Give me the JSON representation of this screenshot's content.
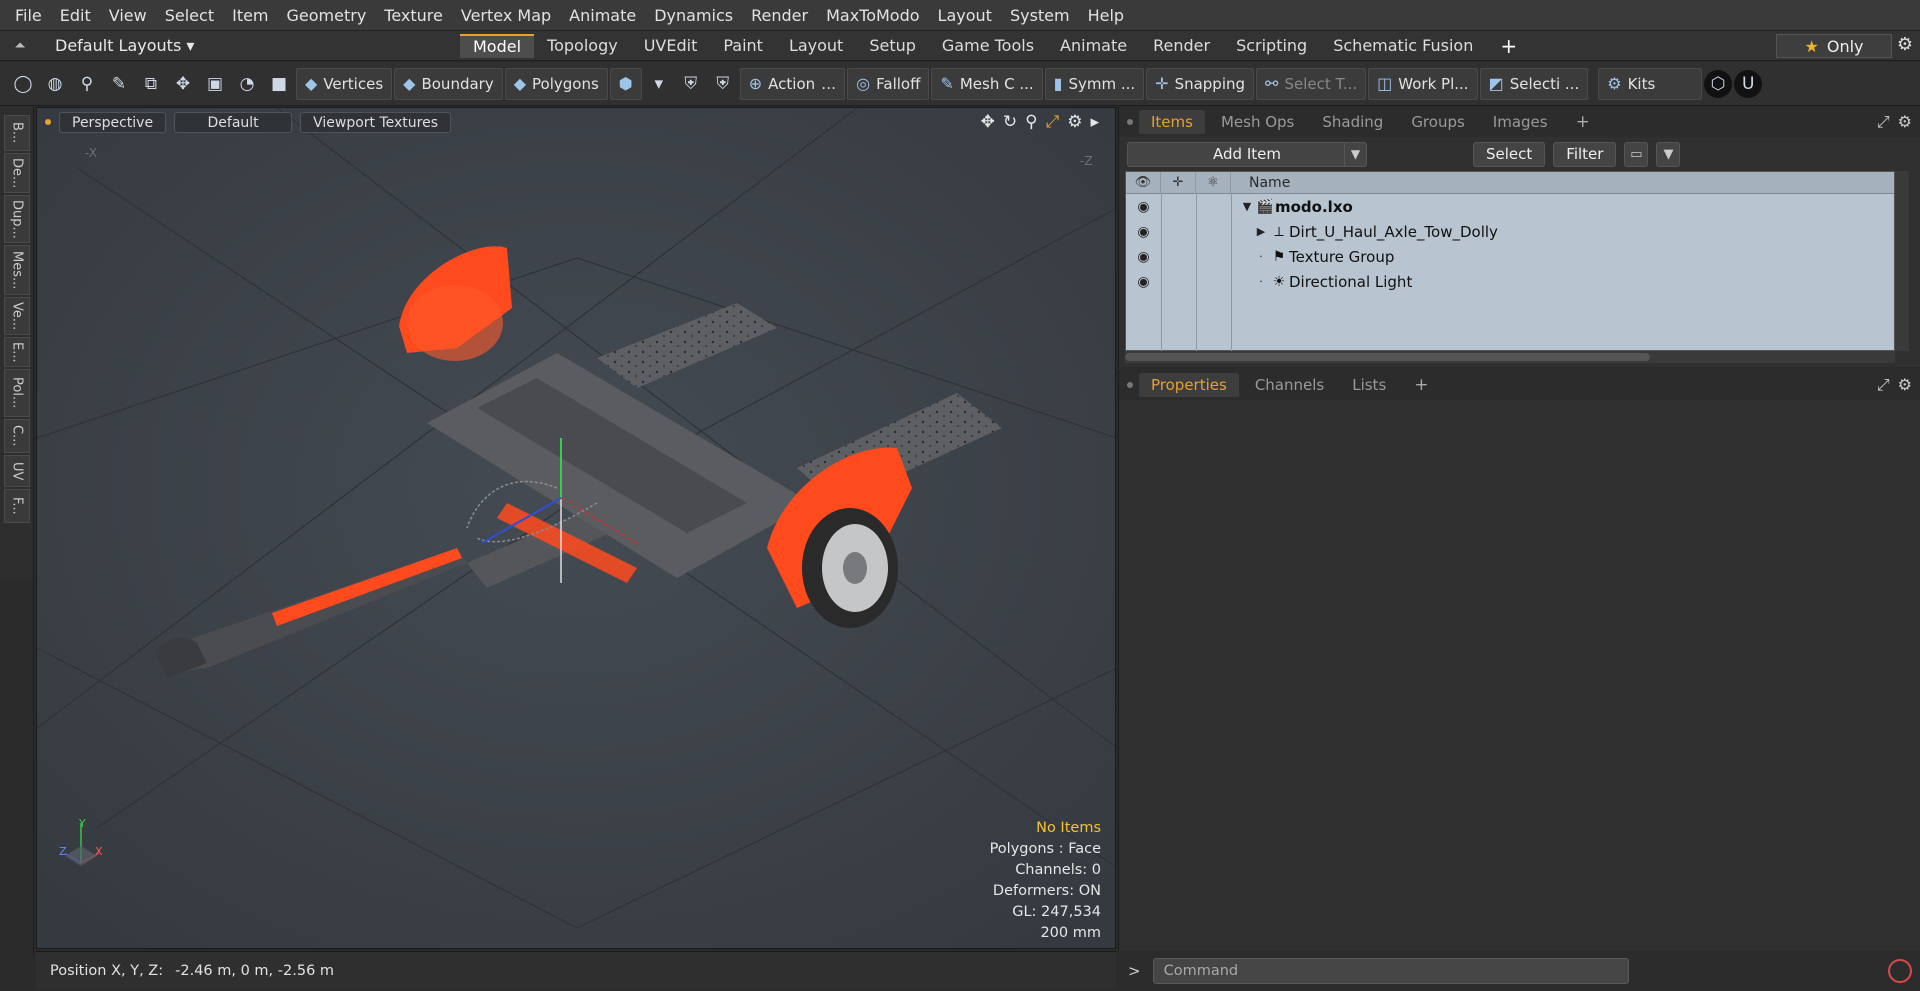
{
  "menu": [
    "File",
    "Edit",
    "View",
    "Select",
    "Item",
    "Geometry",
    "Texture",
    "Vertex Map",
    "Animate",
    "Dynamics",
    "Render",
    "MaxToModo",
    "Layout",
    "System",
    "Help"
  ],
  "layout_bar": {
    "layouts_label": "Default Layouts ▾",
    "tabs": [
      "Model",
      "Topology",
      "UVEdit",
      "Paint",
      "Layout",
      "Setup",
      "Game Tools",
      "Animate",
      "Render",
      "Scripting",
      "Schematic Fusion"
    ],
    "active_tab": "Model",
    "only_label": "Only"
  },
  "toolbar": {
    "vertices": "Vertices",
    "boundary": "Boundary",
    "polygons": "Polygons",
    "action": "Action",
    "falloff": "Falloff",
    "mesh": "Mesh C ...",
    "symm": "Symm ...",
    "snapping": "Snapping",
    "select_t": "Select T...",
    "workplane": "Work Pl...",
    "selecti": "Selecti ...",
    "kits": "Kits"
  },
  "left_tabs": [
    "B...",
    "De...",
    "Dup...",
    "Mes...",
    "Ve...",
    "E...",
    "Pol...",
    "C...",
    "UV",
    "F..."
  ],
  "viewport": {
    "view_mode": "Perspective",
    "shading": "Default",
    "textures": "Viewport Textures",
    "axis_x_neg": "-X",
    "axis_z_neg": "-Z",
    "info": {
      "items": "No Items",
      "polygons": "Polygons : Face",
      "channels": "Channels: 0",
      "deformers": "Deformers: ON",
      "gl": "GL: 247,534",
      "scale": "200 mm"
    },
    "gizmo": {
      "y": "Y",
      "z": "Z",
      "x": "X"
    }
  },
  "status": {
    "label": "Position X, Y, Z:",
    "value": "-2.46 m, 0 m, -2.56 m"
  },
  "items_panel": {
    "tabs": [
      "Items",
      "Mesh Ops",
      "Shading",
      "Groups",
      "Images"
    ],
    "active_tab": "Items",
    "add_item": "Add Item",
    "select": "Select",
    "filter": "Filter",
    "name_header": "Name",
    "tree": [
      {
        "label": "modo.lxo",
        "bold": true,
        "icon": "scene-icon"
      },
      {
        "label": "Dirt_U_Haul_Axle_Tow_Dolly",
        "bold": false,
        "icon": "mesh-locator-icon"
      },
      {
        "label": "Texture Group",
        "bold": false,
        "icon": "texture-group-icon"
      },
      {
        "label": "Directional Light",
        "bold": false,
        "icon": "light-icon"
      }
    ]
  },
  "props_panel": {
    "tabs": [
      "Properties",
      "Channels",
      "Lists"
    ],
    "active_tab": "Properties"
  },
  "command": {
    "placeholder": "Command",
    "prompt": ">"
  },
  "colors": {
    "accent": "#e8a030",
    "viewport_bg": "#3c4148",
    "tree_bg": "#b8c4cf",
    "orange_part": "#ff4a1e"
  }
}
